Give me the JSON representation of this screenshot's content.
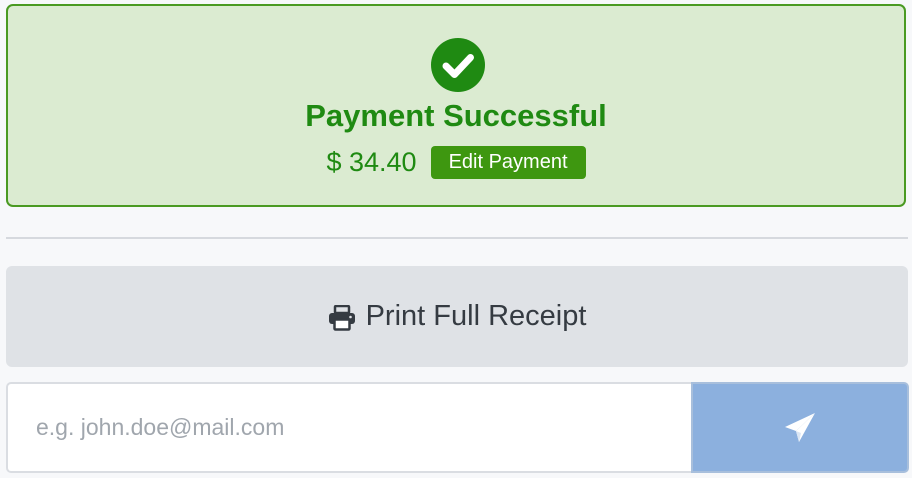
{
  "payment": {
    "status_title": "Payment Successful",
    "amount": "$ 34.40",
    "edit_label": "Edit Payment",
    "status_icon": "check-circle-icon"
  },
  "receipt": {
    "print_label": "Print Full Receipt",
    "print_icon": "printer-icon"
  },
  "email": {
    "placeholder": "e.g. john.doe@mail.com",
    "value": "",
    "send_icon": "paper-plane-icon"
  },
  "colors": {
    "success_bg": "#dbebd1",
    "success_border": "#4a9a22",
    "success_text": "#1f8a12",
    "edit_button": "#3e9710",
    "print_button": "#dfe2e6",
    "send_button": "#8cb0de"
  }
}
